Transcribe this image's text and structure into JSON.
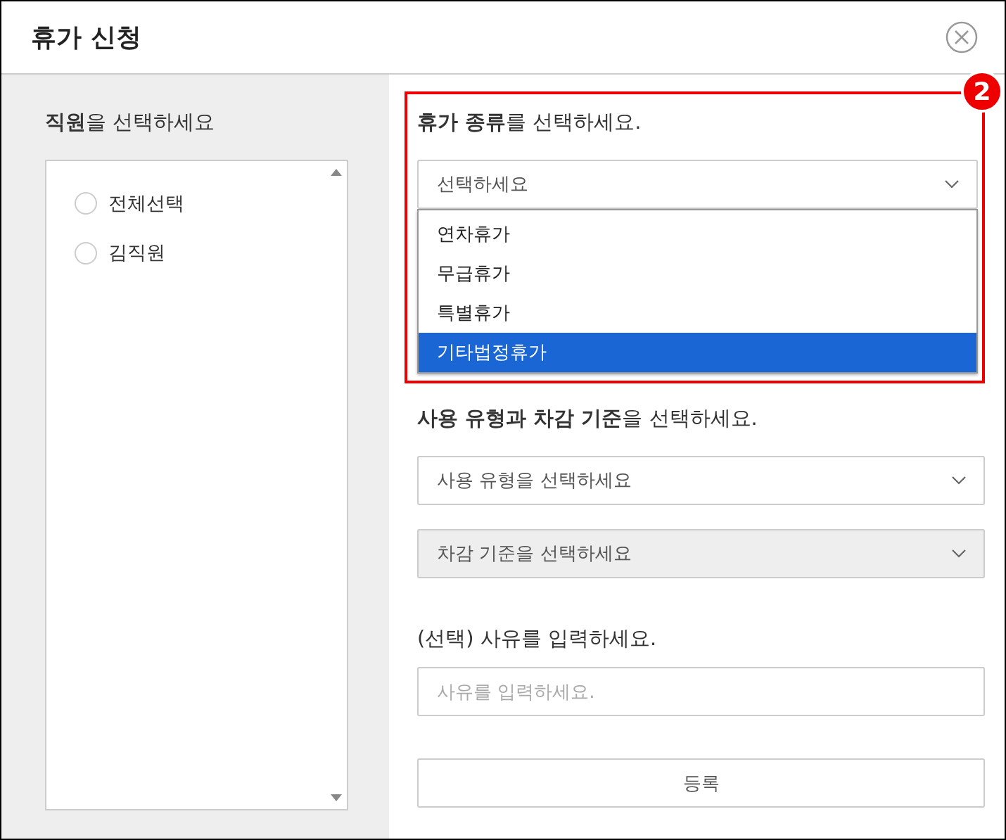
{
  "dialog": {
    "title": "휴가 신청"
  },
  "employee_panel": {
    "label": "**직원**을 선택하세요",
    "options": [
      {
        "label": "전체선택",
        "selected": false
      },
      {
        "label": "김직원",
        "selected": false
      }
    ]
  },
  "leave_type": {
    "label": "**휴가 종류**를 선택하세요.",
    "select": {
      "placeholder": "선택하세요",
      "expanded": true
    },
    "options": [
      {
        "label": "연차휴가",
        "selected": false
      },
      {
        "label": "무급휴가",
        "selected": false
      },
      {
        "label": "특별휴가",
        "selected": false
      },
      {
        "label": "기타법정휴가",
        "selected": true
      }
    ],
    "annotation": {
      "number": "2"
    }
  },
  "usage": {
    "label": "**사용 유형과 차감 기준**을 선택하세요.",
    "usage_type": {
      "placeholder": "사용 유형을 선택하세요",
      "disabled": false
    },
    "deduction": {
      "placeholder": "차감 기준을 선택하세요",
      "disabled": true
    }
  },
  "reason": {
    "label": "(선택) 사유를 입력하세요.",
    "placeholder": "사유를 입력하세요."
  },
  "submit": {
    "label": "등록"
  }
}
